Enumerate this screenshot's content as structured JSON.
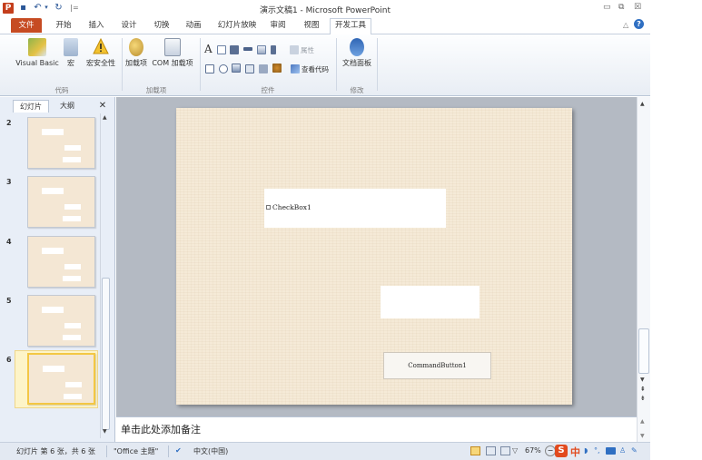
{
  "titlebar": {
    "title": "演示文稿1 - Microsoft PowerPoint",
    "app_icon": "P",
    "qat_sep": "|="
  },
  "tabs": [
    "文件",
    "开始",
    "插入",
    "设计",
    "切换",
    "动画",
    "幻灯片放映",
    "审阅",
    "视图",
    "开发工具"
  ],
  "ribbon": {
    "code": {
      "visual_basic": "Visual Basic",
      "macro": "宏",
      "macro_security": "宏安全性",
      "group": "代码"
    },
    "addins": {
      "addins": "加载项",
      "com": "COM 加载项",
      "group": "加载项"
    },
    "controls": {
      "properties": "属性",
      "view_code": "查看代码",
      "group": "控件"
    },
    "modify": {
      "document_panel": "文档面板",
      "group": "修改"
    }
  },
  "left_panel": {
    "tab_slides": "幻灯片",
    "tab_outline": "大纲",
    "close": "✕",
    "slides": [
      {
        "number": "2"
      },
      {
        "number": "3"
      },
      {
        "number": "4"
      },
      {
        "number": "5"
      },
      {
        "number": "6"
      }
    ]
  },
  "slide": {
    "checkbox_label": "CheckBox1",
    "command_button": "CommandButton1"
  },
  "notes": {
    "placeholder": "单击此处添加备注"
  },
  "status": {
    "slide_info": "幻灯片 第 6 张，共 6 张",
    "theme": "\"Office 主题\"",
    "language": "中文(中国)",
    "zoom": "67%"
  },
  "ime": {
    "label": "中"
  },
  "colors": {
    "file_tab": "#c64b22",
    "slide_bg": "#f5ead7",
    "ribbon_bg": "#e8edf4"
  }
}
